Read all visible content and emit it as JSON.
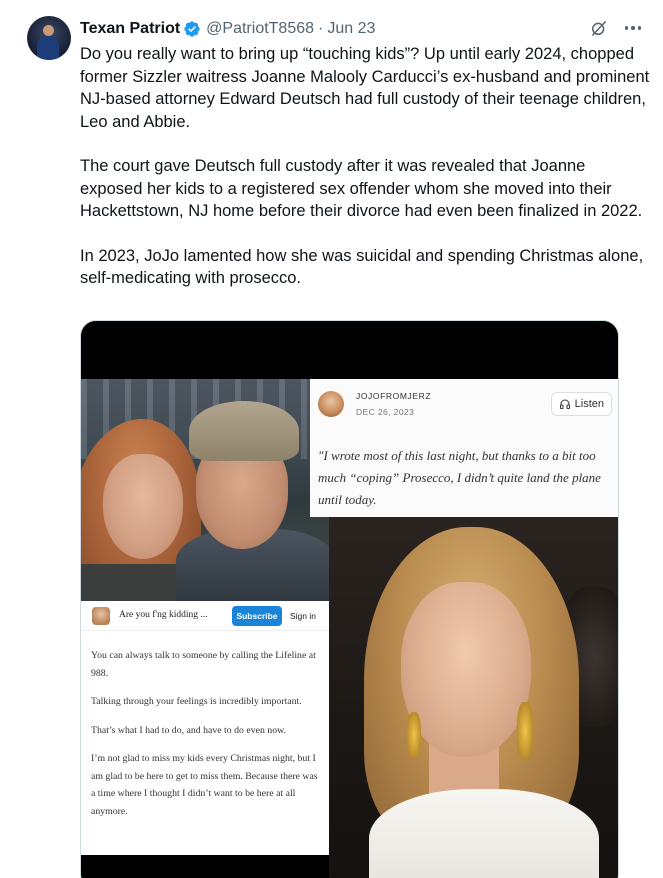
{
  "tweet": {
    "author_name": "Texan Patriot",
    "handle": "@PatriotT8568",
    "separator": "·",
    "date": "Jun 23",
    "paragraphs": [
      "Do you really want to bring up “touching kids”? Up until early 2024, chopped former Sizzler waitress Joanne Malooly Carducci’s ex-husband and prominent NJ-based attorney Edward Deutsch had full custody of their teenage children, Leo and Abbie.",
      "The court gave Deutsch full custody after it was revealed that Joanne exposed her kids to a registered sex offender whom she moved into their Hackettstown, NJ home before their divorce had even been finalized in 2022.",
      "In 2023, JoJo lamented how she was suicidal and spending Christmas alone, self-medicating with prosecco."
    ],
    "colors": {
      "text": "#0f1419",
      "muted": "#536471",
      "verified": "#1d9bf0"
    },
    "icons": [
      "verified-badge-icon",
      "grok-icon",
      "more-icon"
    ]
  },
  "media": {
    "blog": {
      "author": "JOJOFROMJERZ",
      "date": "DEC 26, 2023",
      "listen_label": "Listen",
      "quote": "\"I wrote most of this last night, but thanks to a bit too much “coping” Prosecco, I didn’t quite land the plane until today."
    },
    "substack": {
      "title": "Are you f'ng kidding ...",
      "subscribe_label": "Subscribe",
      "signin_label": "Sign in",
      "paragraphs": [
        "You can always talk to someone by calling the Lifeline at 988.",
        "Talking through your feelings is incredibly important.",
        "That’s what I had to do, and have to do even now.",
        "I’m not glad to miss my kids every Christmas night, but I am glad to be here to get to miss them. Because there was a time where I thought I didn’t want to be here at all anymore."
      ]
    }
  }
}
